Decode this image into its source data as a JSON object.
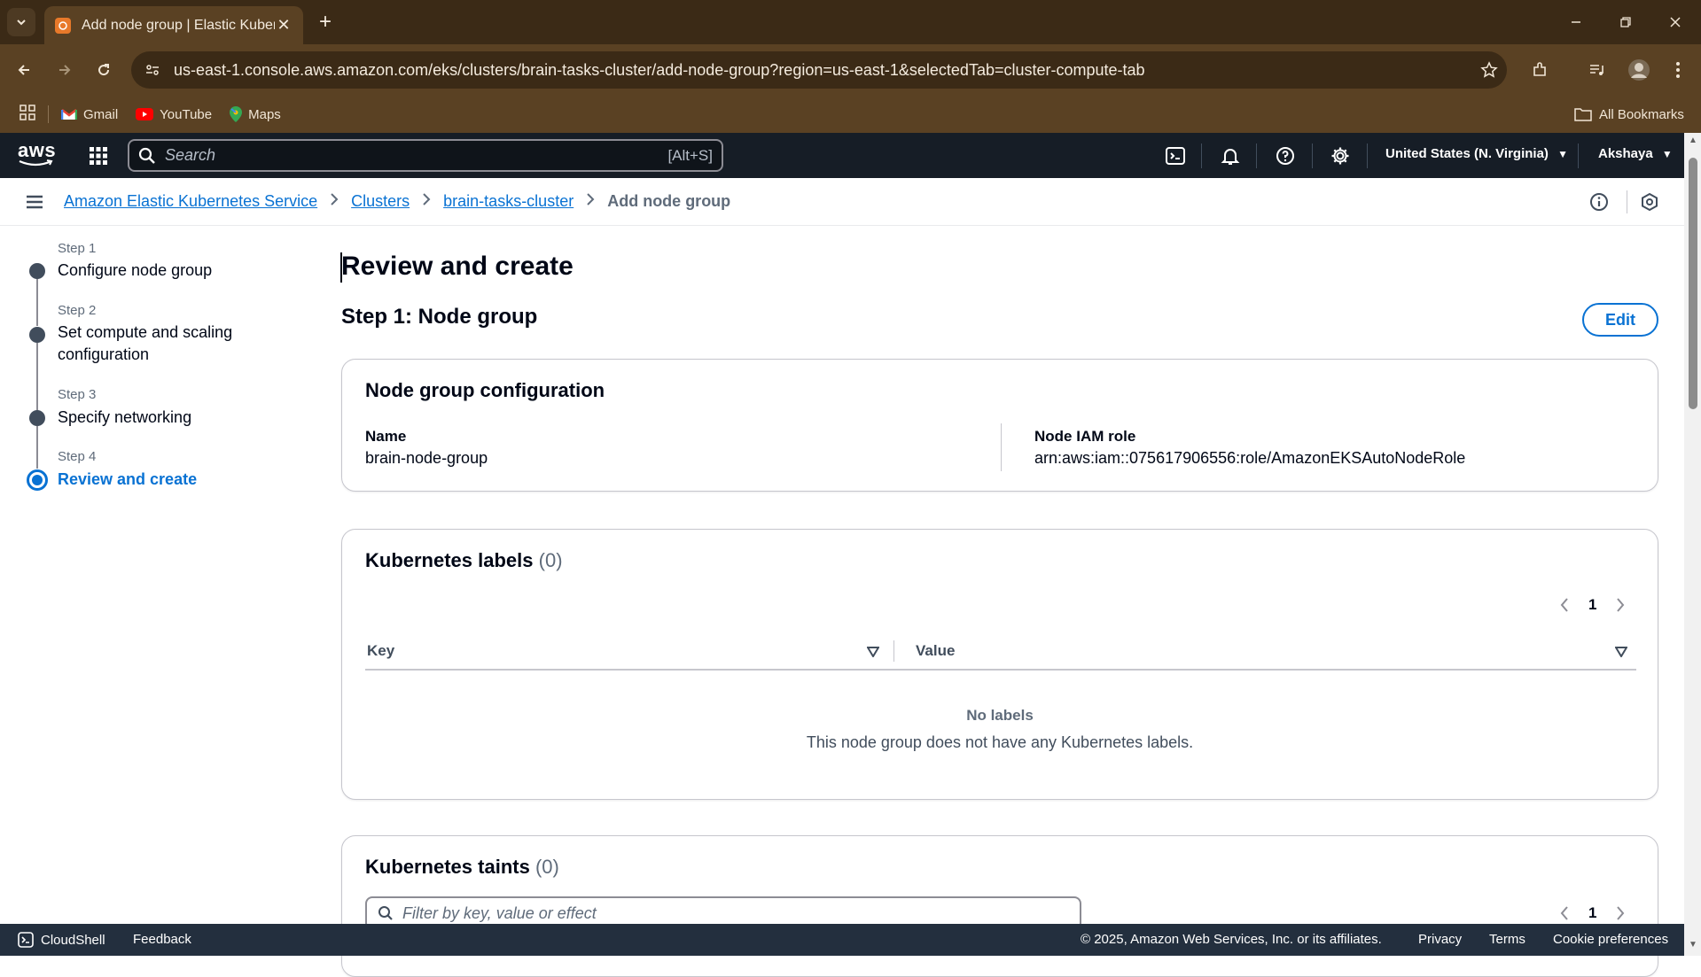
{
  "browser": {
    "tab_title": "Add node group | Elastic Kubernetes",
    "url": "us-east-1.console.aws.amazon.com/eks/clusters/brain-tasks-cluster/add-node-group?region=us-east-1&selectedTab=cluster-compute-tab",
    "bookmarks": [
      {
        "label": "Gmail",
        "icon": "gmail-icon"
      },
      {
        "label": "YouTube",
        "icon": "youtube-icon"
      },
      {
        "label": "Maps",
        "icon": "maps-icon"
      }
    ],
    "all_bookmarks_label": "All Bookmarks"
  },
  "aws_header": {
    "logo_text": "aws",
    "search_placeholder": "Search",
    "search_shortcut": "[Alt+S]",
    "region": "United States (N. Virginia)",
    "user": "Akshaya"
  },
  "breadcrumb": {
    "items": [
      {
        "label": "Amazon Elastic Kubernetes Service"
      },
      {
        "label": "Clusters"
      },
      {
        "label": "brain-tasks-cluster"
      }
    ],
    "current": "Add node group"
  },
  "steps": [
    {
      "step": "Step 1",
      "label": "Configure node group"
    },
    {
      "step": "Step 2",
      "label": "Set compute and scaling configuration"
    },
    {
      "step": "Step 3",
      "label": "Specify networking"
    },
    {
      "step": "Step 4",
      "label": "Review and create",
      "active": true
    }
  ],
  "main": {
    "title": "Review and create",
    "section_title": "Step 1: Node group",
    "edit_label": "Edit",
    "node_group_config": {
      "title": "Node group configuration",
      "name_label": "Name",
      "name_value": "brain-node-group",
      "role_label": "Node IAM role",
      "role_value": "arn:aws:iam::075617906556:role/AmazonEKSAutoNodeRole"
    },
    "labels": {
      "title": "Kubernetes labels",
      "count": "(0)",
      "page": "1",
      "columns": [
        "Key",
        "Value"
      ],
      "empty_title": "No labels",
      "empty_desc": "This node group does not have any Kubernetes labels."
    },
    "taints": {
      "title": "Kubernetes taints",
      "count": "(0)",
      "filter_placeholder": "Filter by key, value or effect",
      "page": "1"
    }
  },
  "footer": {
    "cloudshell": "CloudShell",
    "feedback": "Feedback",
    "copyright": "© 2025, Amazon Web Services, Inc. or its affiliates.",
    "privacy": "Privacy",
    "terms": "Terms",
    "cookie": "Cookie preferences"
  },
  "colors": {
    "link": "#0972d3",
    "aws_header_bg": "#161d26",
    "footer_bg": "#232f3e",
    "browser_chrome": "#5a4123"
  }
}
